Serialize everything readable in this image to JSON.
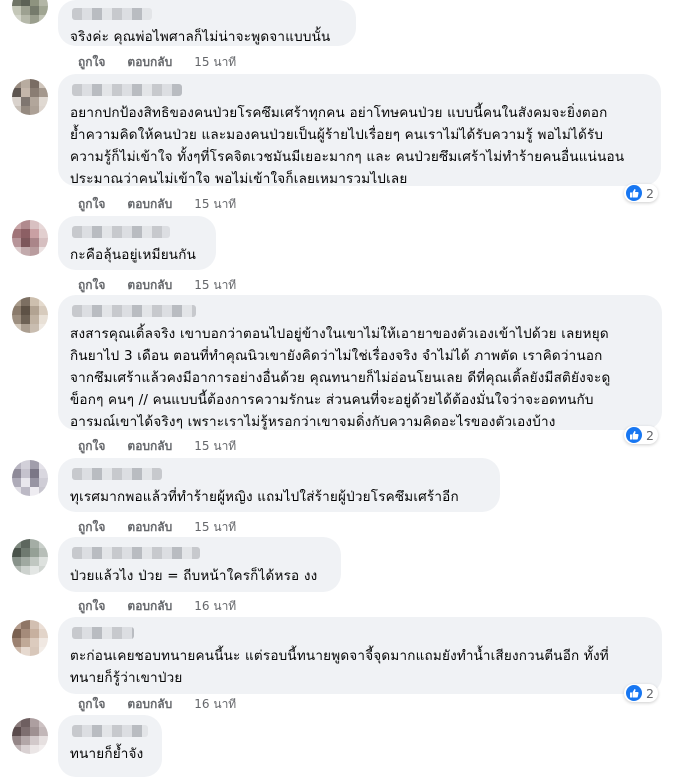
{
  "action_labels": {
    "like": "ถูกใจ",
    "reply": "ตอบกลับ"
  },
  "colors": {
    "like_blue": "#1877f2",
    "bubble_bg": "#f0f2f5",
    "meta_gray": "#65676b"
  },
  "comments": [
    {
      "text": "จริงค่ะ คุณพ่อไพศาลก็ไม่น่าจะพูดจาแบบนั้น",
      "time": "15 นาที",
      "reactions": ""
    },
    {
      "text": "อยากปกป้องสิทธิของคนป่วยโรคซึมเศร้าทุกคน อย่าโทษคนป่วย แบบนี้คนในสังคมจะยิ่งตอก\nย้ำความคิดให้คนป่วย และมองคนป่วยเป็นผู้ร้ายไปเรื่อยๆ คนเราไม่ได้รับความรู้ พอไม่ได้รับ\nความรู้ก็ไม่เข้าใจ ทั้งๆที่โรคจิตเวชมันมีเยอะมากๆ และ คนป่วยซึมเศร้าไม่ทำร้ายคนอื่นแน่นอน\nประมาณว่าคนไม่เข้าใจ พอไม่เข้าใจก็เลยเหมารวมไปเลย",
      "time": "15 นาที",
      "reactions": "2"
    },
    {
      "text": "กะคือลุ้นอยู่เหมียนกัน",
      "time": "15 นาที",
      "reactions": ""
    },
    {
      "text": "สงสารคุณเติ้ลจริง เขาบอกว่าตอนไปอยู่ข้างในเขาไม่ให้เอายาของตัวเองเข้าไปด้วย เลยหยุด\nกินยาไป 3 เดือน ตอนที่ทำคุณนิวเขายังคิดว่าไม่ใช่เรื่องจริง จำไม่ได้ ภาพตัด เราคิดว่านอก\nจากซึมเศร้าแล้วคงมีอาการอย่างอื่นด้วย คุณทนายก็ไม่อ่อนโยนเลย ดีที่คุณเติ้ลยังมีสติยังจะดู\nข็อกๆ คนๆ // คนแบบนี้ต้องการความรักนะ ส่วนคนที่จะอยู่ด้วยได้ต้องมั่นใจว่าจะอดทนกับ\nอารมณ์เขาได้จริงๆ เพราะเราไม่รู้หรอกว่าเขาจมดิ่งกับความคิดอะไรของตัวเองบ้าง",
      "time": "15 นาที",
      "reactions": "2"
    },
    {
      "text": "ทุเรศมากพอแล้วที่ทำร้ายผู้หญิง แถมไปใส่ร้ายผู้ป่วยโรคซึมเศร้าอีก",
      "time": "15 นาที",
      "reactions": ""
    },
    {
      "text": "ป่วยแล้วไง ป่วย = ถีบหน้าใครก็ได้หรอ งง",
      "time": "16 นาที",
      "reactions": ""
    },
    {
      "text": "ตะก่อนเคยชอบทนายคนนี้นะ แต่รอบนี้ทนายพูดจาจี้จุดมากแถมยังทำน้ำเสียงกวนตีนอีก ทั้งที่\nทนายก็รู้ว่าเขาป่วย",
      "time": "16 นาที",
      "reactions": "2"
    },
    {
      "text": "ทนายก็ย้ำจัง",
      "time": "",
      "reactions": ""
    }
  ]
}
